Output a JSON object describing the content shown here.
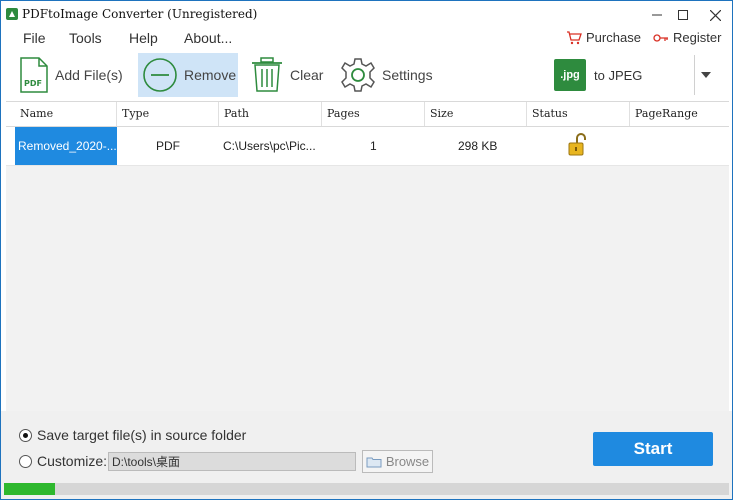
{
  "window": {
    "title": "PDFtoImage Converter (Unregistered)"
  },
  "menu": {
    "file": "File",
    "tools": "Tools",
    "help": "Help",
    "about": "About..."
  },
  "links": {
    "purchase": "Purchase",
    "register": "Register"
  },
  "toolbar": {
    "add_files": "Add File(s)",
    "remove": "Remove",
    "clear": "Clear",
    "settings": "Settings",
    "format_badge": ".jpg",
    "format_label": "to JPEG"
  },
  "table": {
    "columns": [
      "Name",
      "Type",
      "Path",
      "Pages",
      "Size",
      "Status",
      "PageRange"
    ],
    "rows": [
      {
        "name": "Removed_2020-...",
        "type": "PDF",
        "path": "C:\\Users\\pc\\Pic...",
        "pages": "1",
        "size": "298 KB",
        "status_icon": "unlocked-padlock-icon",
        "page_range": ""
      }
    ]
  },
  "output": {
    "source_option": "Save target file(s) in source folder",
    "customize_option": "Customize:",
    "selected": "source",
    "custom_path": "D:\\tools\\桌面",
    "browse": "Browse"
  },
  "start_label": "Start",
  "progress": {
    "fraction": 0.07
  },
  "colors": {
    "accent": "#1f8ae0",
    "progress": "#2eb82e",
    "icon_green": "#2e8b3e"
  }
}
